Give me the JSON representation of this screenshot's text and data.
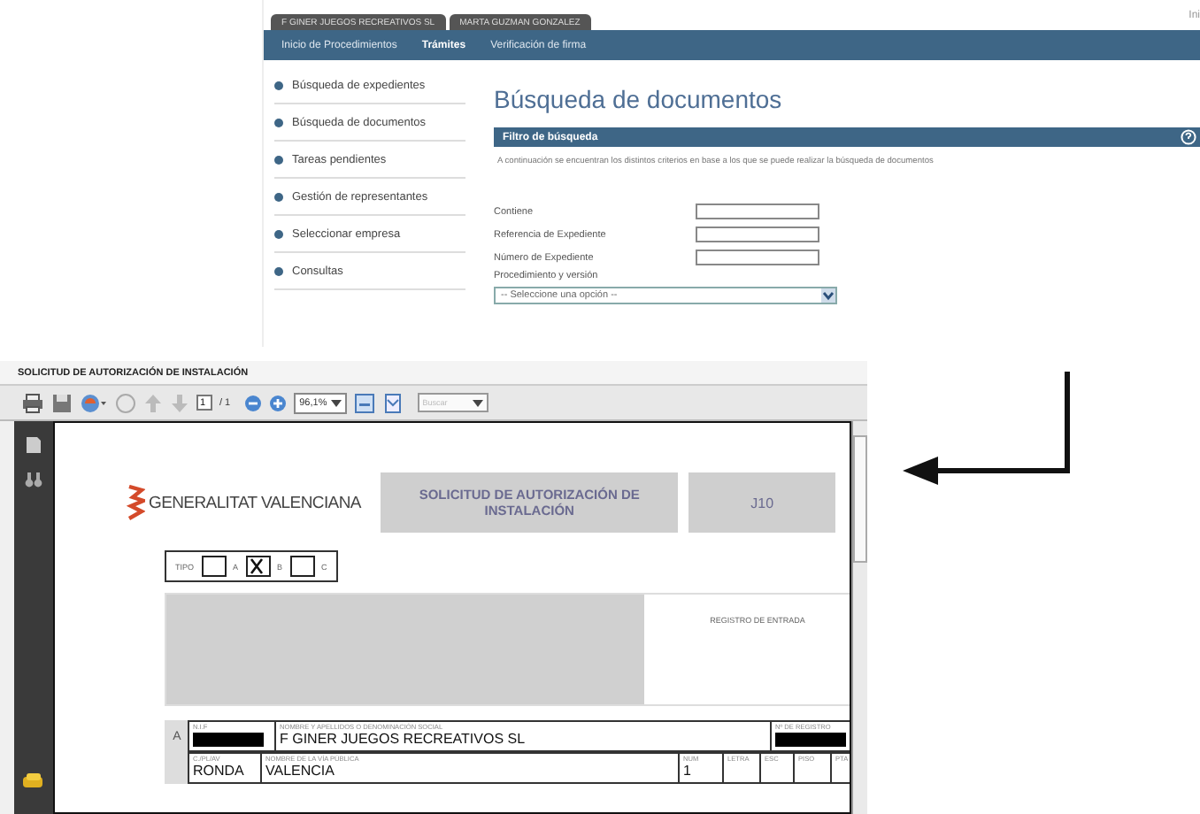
{
  "portal": {
    "user_tabs": [
      {
        "label": "F GINER JUEGOS RECREATIVOS SL"
      },
      {
        "label": "MARTA GUZMAN GONZALEZ"
      }
    ],
    "corner_text": "Ini",
    "nav": [
      {
        "label": "Inicio de Procedimientos",
        "selected": false
      },
      {
        "label": "Trámites",
        "selected": true
      },
      {
        "label": "Verificación de firma",
        "selected": false
      }
    ],
    "sidebar": [
      "Búsqueda de expedientes",
      "Búsqueda de documentos",
      "Tareas pendientes",
      "Gestión de representantes",
      "Seleccionar empresa",
      "Consultas"
    ],
    "page_title": "Búsqueda de documentos",
    "filter": {
      "title": "Filtro de búsqueda",
      "description": "A continuación se encuentran los distintos criterios en base a los que se puede realizar la búsqueda de documentos",
      "fields": [
        {
          "label": "Contiene",
          "kind": "text"
        },
        {
          "label": "Referencia de Expediente",
          "kind": "text"
        },
        {
          "label": "Número de Expediente",
          "kind": "text"
        },
        {
          "label": "Procedimiento y versión",
          "kind": "select",
          "placeholder": "-- Seleccione una opción --"
        }
      ]
    }
  },
  "pdf_viewer": {
    "title": "SOLICITUD DE AUTORIZACIÓN DE INSTALACIÓN",
    "toolbar": {
      "page": "1",
      "page_total": "/ 1",
      "zoom": "96,1%",
      "search_placeholder": "Buscar"
    },
    "document": {
      "logo": "GENERALITAT VALENCIANA",
      "heading": "SOLICITUD DE AUTORIZACIÓN DE INSTALACIÓN",
      "code": "J10",
      "tipo_label": "TIPO",
      "tipo_options": [
        {
          "label": "A",
          "checked": false
        },
        {
          "label": "B",
          "checked": true
        },
        {
          "label": "C",
          "checked": false
        }
      ],
      "registry_label": "REGISTRO DE ENTRADA",
      "section": "A",
      "row_1": [
        {
          "label": "N.I.F",
          "redacted": true
        },
        {
          "label": "NOMBRE Y APELLIDOS O DENOMINACIÓN SOCIAL",
          "value": "F GINER JUEGOS RECREATIVOS SL",
          "redacted": false
        },
        {
          "label": "Nº DE REGISTRO",
          "redacted": true
        }
      ],
      "row_2": [
        {
          "label": "C./PL/AV",
          "value": "RONDA"
        },
        {
          "label": "NOMBRE DE LA VÍA PÚBLICA",
          "value": "VALENCIA"
        },
        {
          "label": "NUM",
          "value": "1"
        },
        {
          "label": "LETRA"
        },
        {
          "label": "ESC"
        },
        {
          "label": "PISO"
        },
        {
          "label": "PTA"
        }
      ]
    }
  }
}
